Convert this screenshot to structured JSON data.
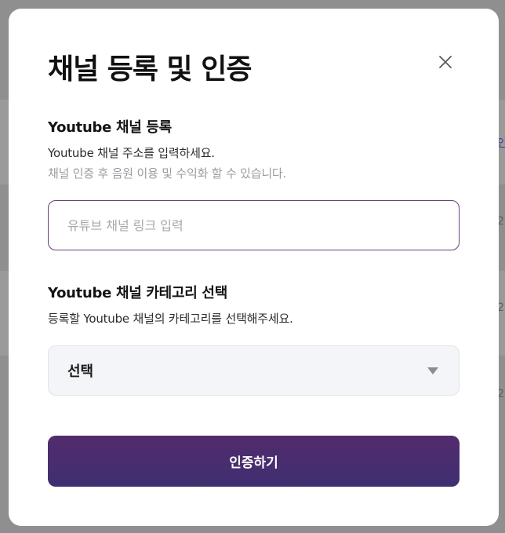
{
  "background": {
    "fragments": [
      "인",
      "2",
      "2",
      "2"
    ]
  },
  "modal": {
    "title": "채널 등록 및 인증",
    "close_icon": "close-icon",
    "channel_section": {
      "title": "Youtube 채널 등록",
      "description": "Youtube 채널 주소를 입력하세요.",
      "hint": "채널 인증 후 음원 이용 및 수익화 할 수 있습니다.",
      "input_placeholder": "유튜브 채널 링크 입력",
      "input_value": ""
    },
    "category_section": {
      "title": "Youtube 채널 카테고리 선택",
      "description": "등록할 Youtube 채널의 카테고리를 선택해주세요.",
      "select_value": "선택",
      "caret_icon": "caret-down-icon"
    },
    "submit_label": "인증하기"
  },
  "colors": {
    "accent_border": "#6a3e7c",
    "button_gradient_top": "#522b6e",
    "button_gradient_bottom": "#3f2f70",
    "select_bg": "#f3f5f8"
  }
}
